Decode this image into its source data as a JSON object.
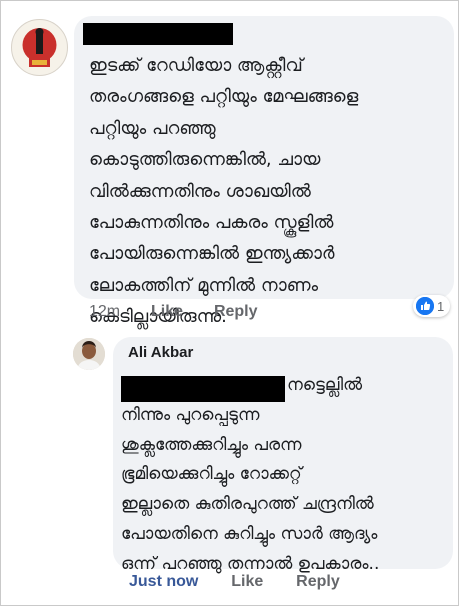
{
  "comment": {
    "lines": [
      "ഇടക്ക് റേഡിയോ ആക്റ്റീവ്",
      "തരംഗങ്ങളെ പറ്റിയും മേഘങ്ങളെ",
      "പറ്റിയും പറഞ്ഞു",
      "കൊടുത്തിരുന്നെങ്കിൽ, ചായ",
      "വിൽക്കുന്നതിനും  ശാഖയിൽ",
      "പോകുന്നതിനും പകരം സ്കൂളിൽ",
      "പോയിരുന്നെങ്കിൽ ഇന്ത്യക്കാർ",
      "ലോകത്തിന് മുന്നിൽ നാണം",
      "കെടില്ലായിരുന്നു."
    ],
    "time": "12m",
    "like_label": "Like",
    "reply_label": "Reply",
    "reaction_count": "1"
  },
  "reply": {
    "author": "Ali Akbar",
    "lines": [
      "നട്ടെല്ലിൽ",
      "നിന്നും പുറപ്പെടുന്ന",
      "ശുക്ലത്തേക്കുറിച്ചും പരന്ന",
      "ഭൂമിയെക്കുറിച്ചും റോക്കറ്റ്",
      "ഇല്ലാതെ കുതിരപുറത്ത് ചന്ദ്രനിൽ",
      "പോയതിനെ കുറിച്ചും സാർ ആദ്യം",
      "ഒന്ന് പറഞ്ഞു തന്നാൽ ഉപകാരം.."
    ],
    "time": "Just now",
    "like_label": "Like",
    "reply_label": "Reply"
  },
  "colors": {
    "bubble": "#f0f2f5",
    "link_blue": "#385898",
    "like_blue": "#1877f2",
    "meta_gray": "#65676b"
  },
  "icons": [
    "like-reaction-icon"
  ]
}
